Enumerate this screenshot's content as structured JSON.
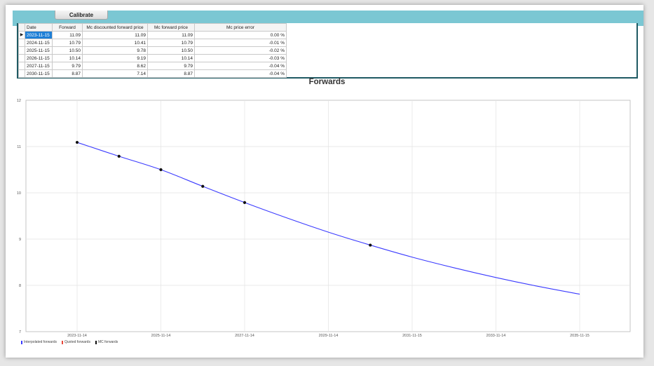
{
  "toolbar": {
    "calibrate_label": "Calibrate"
  },
  "grid": {
    "columns": [
      "Date",
      "Forward",
      "Mc discounted forward price",
      "Mc forward price",
      "Mc price error"
    ],
    "rows": [
      {
        "date": "2023-11-15",
        "forward": "11.09",
        "mc_disc": "11.09",
        "mc_fwd": "11.09",
        "err": "0.00 %"
      },
      {
        "date": "2024-11-15",
        "forward": "10.79",
        "mc_disc": "10.41",
        "mc_fwd": "10.79",
        "err": "-0.01 %"
      },
      {
        "date": "2025-11-15",
        "forward": "10.50",
        "mc_disc": "9.78",
        "mc_fwd": "10.50",
        "err": "-0.02 %"
      },
      {
        "date": "2026-11-15",
        "forward": "10.14",
        "mc_disc": "9.19",
        "mc_fwd": "10.14",
        "err": "-0.03 %"
      },
      {
        "date": "2027-11-15",
        "forward": "9.79",
        "mc_disc": "8.62",
        "mc_fwd": "9.79",
        "err": "-0.04 %"
      },
      {
        "date": "2030-11-15",
        "forward": "8.87",
        "mc_disc": "7.14",
        "mc_fwd": "8.87",
        "err": "-0.04 %"
      }
    ],
    "selected_marker": "▶"
  },
  "chart_data": {
    "type": "line",
    "title": "Forwards",
    "xlabel": "",
    "ylabel": "",
    "ylim": [
      7,
      12
    ],
    "yticks": [
      "7",
      "8",
      "9",
      "10",
      "11",
      "12"
    ],
    "xticks": [
      "2023-11-14",
      "2025-11-14",
      "2027-11-14",
      "2029-11-14",
      "2031-11-15",
      "2033-11-14",
      "2035-11-15"
    ],
    "grid": true,
    "legend_position": "bottom-left",
    "series": [
      {
        "name": "Interpolated forwards",
        "color": "#3b3bff",
        "x": [
          "2023-11-15",
          "2024-11-15",
          "2025-11-15",
          "2026-11-15",
          "2027-11-15",
          "2028-11-15",
          "2029-11-15",
          "2030-11-15",
          "2031-11-15",
          "2032-11-15",
          "2033-11-15",
          "2034-11-15",
          "2035-11-15"
        ],
        "values": [
          11.09,
          10.79,
          10.5,
          10.14,
          9.79,
          9.46,
          9.15,
          8.87,
          8.61,
          8.38,
          8.17,
          7.98,
          7.81
        ]
      },
      {
        "name": "Quoted forwards",
        "color": "#e8483b",
        "x": [],
        "values": []
      },
      {
        "name": "MC forwards",
        "color": "#111111",
        "x": [
          "2023-11-15",
          "2024-11-15",
          "2025-11-15",
          "2026-11-15",
          "2027-11-15",
          "2030-11-15"
        ],
        "values": [
          11.09,
          10.79,
          10.5,
          10.14,
          9.79,
          8.87
        ]
      }
    ]
  }
}
